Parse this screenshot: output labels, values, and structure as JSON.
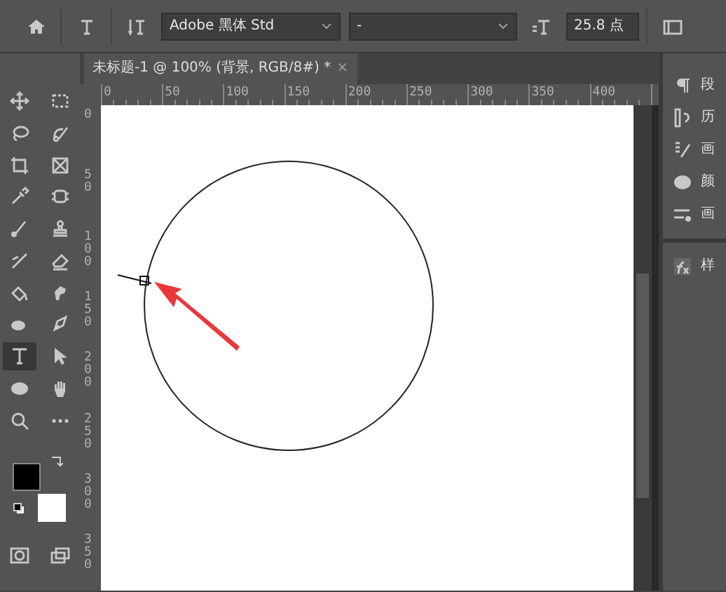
{
  "options_bar": {
    "font_family": "Adobe 黑体 Std",
    "font_style": "-",
    "font_size": "25.8 点"
  },
  "document_tab": {
    "title": "未标题-1 @ 100% (背景, RGB/8#) *",
    "close": "×"
  },
  "tools": [
    {
      "kind": "move",
      "selected": false
    },
    {
      "kind": "marquee",
      "selected": false
    },
    {
      "kind": "lasso",
      "selected": false
    },
    {
      "kind": "quickselect",
      "selected": false
    },
    {
      "kind": "crop",
      "selected": false
    },
    {
      "kind": "frame",
      "selected": false
    },
    {
      "kind": "eyedropper",
      "selected": false
    },
    {
      "kind": "patch",
      "selected": false
    },
    {
      "kind": "brush",
      "selected": false
    },
    {
      "kind": "stamp",
      "selected": false
    },
    {
      "kind": "historybrush",
      "selected": false
    },
    {
      "kind": "eraser",
      "selected": false
    },
    {
      "kind": "bucket",
      "selected": false
    },
    {
      "kind": "smudge",
      "selected": false
    },
    {
      "kind": "dodge",
      "selected": false
    },
    {
      "kind": "pen",
      "selected": false
    },
    {
      "kind": "type",
      "selected": true
    },
    {
      "kind": "pointer",
      "selected": false
    },
    {
      "kind": "ellipse",
      "selected": false
    },
    {
      "kind": "hand",
      "selected": false
    },
    {
      "kind": "zoom",
      "selected": false
    },
    {
      "kind": "more",
      "selected": false
    }
  ],
  "swatches": [
    {
      "kind": "foreground",
      "color": "#000000"
    },
    {
      "kind": "background",
      "color": "#ffffff"
    }
  ],
  "rulers": {
    "horizontal": [
      "0",
      "50",
      "100",
      "150",
      "200",
      "250",
      "300",
      "350",
      "400"
    ],
    "vertical": [
      "0",
      "50",
      "100",
      "150",
      "200",
      "250",
      "300",
      "350"
    ]
  },
  "panels": [
    {
      "kind": "paragraph",
      "label": "段"
    },
    {
      "kind": "history",
      "label": "历"
    },
    {
      "kind": "brushsettings",
      "label": "画"
    },
    {
      "kind": "color",
      "label": "颜"
    },
    {
      "kind": "brushes",
      "label": "画"
    }
  ],
  "styles_panel": {
    "label": "样"
  }
}
